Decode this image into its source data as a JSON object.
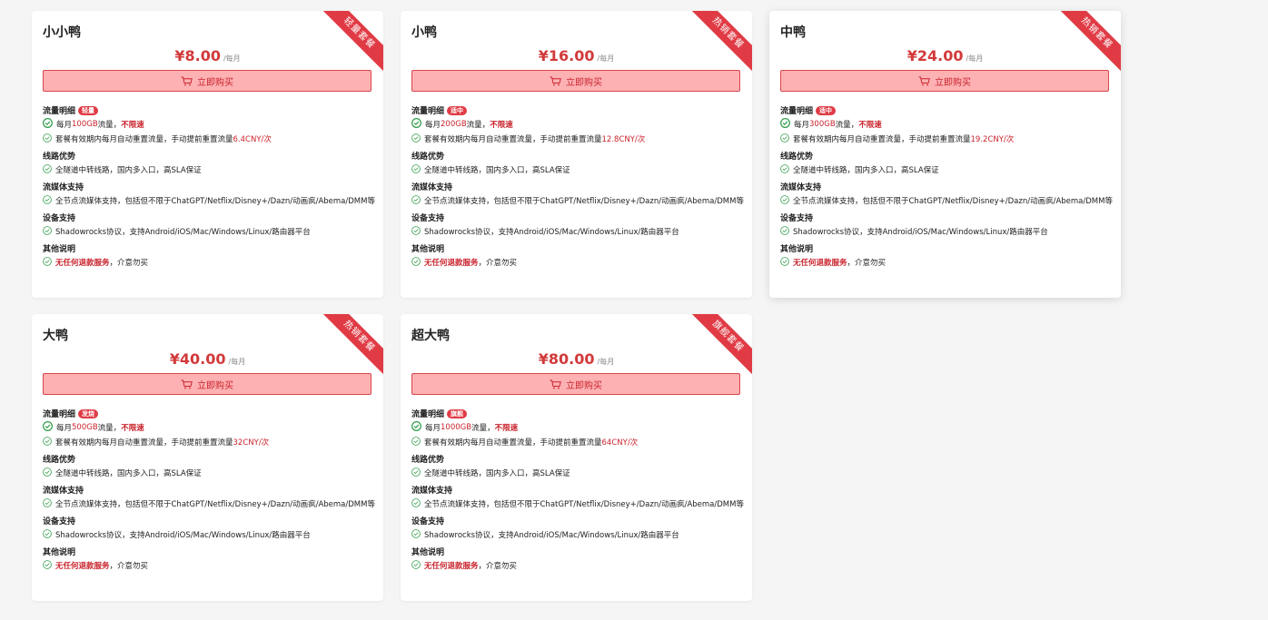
{
  "plans": [
    {
      "name": "小小鸭",
      "ribbon": "轻量套餐",
      "price": "¥8.00",
      "unit": "/每月",
      "buy_label": "立即购买",
      "traffic_title": "流量明细",
      "traffic_badge": "轻量",
      "traffic_prefix": "每月 ",
      "traffic_amount": "100GB",
      "traffic_suffix": " 流量，",
      "traffic_speed": "不限速",
      "reset_text": "套餐有效期内每月自动重置流量，手动提前重置流量 ",
      "reset_price": "6.4CNY/次",
      "route_title": "线路优势",
      "route_text": "全隧道中转线路，国内多入口，高SLA保证",
      "media_title": "流媒体支持",
      "media_text": "全节点流媒体支持，包括但不限于ChatGPT/Netflix/Disney+/Dazn/动画疯/Abema/DMM等",
      "device_title": "设备支持",
      "device_text": "Shadowrocks协议，支持Android/iOS/Mac/Windows/Linux/路由器平台",
      "other_title": "其他说明",
      "other_red": "无任何退款服务",
      "other_rest": "，介意勿买"
    },
    {
      "name": "小鸭",
      "ribbon": "热销套餐",
      "price": "¥16.00",
      "unit": "/每月",
      "buy_label": "立即购买",
      "traffic_title": "流量明细",
      "traffic_badge": "适中",
      "traffic_prefix": "每月 ",
      "traffic_amount": "200GB",
      "traffic_suffix": " 流量，",
      "traffic_speed": "不限速",
      "reset_text": "套餐有效期内每月自动重置流量，手动提前重置流量 ",
      "reset_price": "12.8CNY/次",
      "route_title": "线路优势",
      "route_text": "全隧道中转线路，国内多入口，高SLA保证",
      "media_title": "流媒体支持",
      "media_text": "全节点流媒体支持，包括但不限于ChatGPT/Netflix/Disney+/Dazn/动画疯/Abema/DMM等",
      "device_title": "设备支持",
      "device_text": "Shadowrocks协议，支持Android/iOS/Mac/Windows/Linux/路由器平台",
      "other_title": "其他说明",
      "other_red": "无任何退款服务",
      "other_rest": "，介意勿买"
    },
    {
      "name": "中鸭",
      "ribbon": "热销套餐",
      "price": "¥24.00",
      "unit": "/每月",
      "buy_label": "立即购买",
      "traffic_title": "流量明细",
      "traffic_badge": "适中",
      "traffic_prefix": "每月 ",
      "traffic_amount": "300GB",
      "traffic_suffix": " 流量，",
      "traffic_speed": "不限速",
      "reset_text": "套餐有效期内每月自动重置流量，手动提前重置流量 ",
      "reset_price": "19.2CNY/次",
      "route_title": "线路优势",
      "route_text": "全隧道中转线路，国内多入口，高SLA保证",
      "media_title": "流媒体支持",
      "media_text": "全节点流媒体支持，包括但不限于ChatGPT/Netflix/Disney+/Dazn/动画疯/Abema/DMM等",
      "device_title": "设备支持",
      "device_text": "Shadowrocks协议，支持Android/iOS/Mac/Windows/Linux/路由器平台",
      "other_title": "其他说明",
      "other_red": "无任何退款服务",
      "other_rest": "，介意勿买"
    },
    {
      "name": "大鸭",
      "ribbon": "热销套餐",
      "price": "¥40.00",
      "unit": "/每月",
      "buy_label": "立即购买",
      "traffic_title": "流量明细",
      "traffic_badge": "发烧",
      "traffic_prefix": "每月 ",
      "traffic_amount": "500GB",
      "traffic_suffix": " 流量，",
      "traffic_speed": "不限速",
      "reset_text": "套餐有效期内每月自动重置流量，手动提前重置流量 ",
      "reset_price": "32CNY/次",
      "route_title": "线路优势",
      "route_text": "全隧道中转线路，国内多入口，高SLA保证",
      "media_title": "流媒体支持",
      "media_text": "全节点流媒体支持，包括但不限于ChatGPT/Netflix/Disney+/Dazn/动画疯/Abema/DMM等",
      "device_title": "设备支持",
      "device_text": "Shadowrocks协议，支持Android/iOS/Mac/Windows/Linux/路由器平台",
      "other_title": "其他说明",
      "other_red": "无任何退款服务",
      "other_rest": "，介意勿买"
    },
    {
      "name": "超大鸭",
      "ribbon": "旗舰套餐",
      "price": "¥80.00",
      "unit": "/每月",
      "buy_label": "立即购买",
      "traffic_title": "流量明细",
      "traffic_badge": "旗舰",
      "traffic_prefix": "每月 ",
      "traffic_amount": "1000GB",
      "traffic_suffix": " 流量，",
      "traffic_speed": "不限速",
      "reset_text": "套餐有效期内每月自动重置流量，手动提前重置流量 ",
      "reset_price": "64CNY/次",
      "route_title": "线路优势",
      "route_text": "全隧道中转线路，国内多入口，高SLA保证",
      "media_title": "流媒体支持",
      "media_text": "全节点流媒体支持，包括但不限于ChatGPT/Netflix/Disney+/Dazn/动画疯/Abema/DMM等",
      "device_title": "设备支持",
      "device_text": "Shadowrocks协议，支持Android/iOS/Mac/Windows/Linux/路由器平台",
      "other_title": "其他说明",
      "other_red": "无任何退款服务",
      "other_rest": "，介意勿买"
    }
  ],
  "colors": {
    "accent": "#d23a3a",
    "ribbon": "#e03b45",
    "button_bg": "#fdb1b3",
    "button_border": "#d9454c",
    "check": "#2e9c47"
  }
}
